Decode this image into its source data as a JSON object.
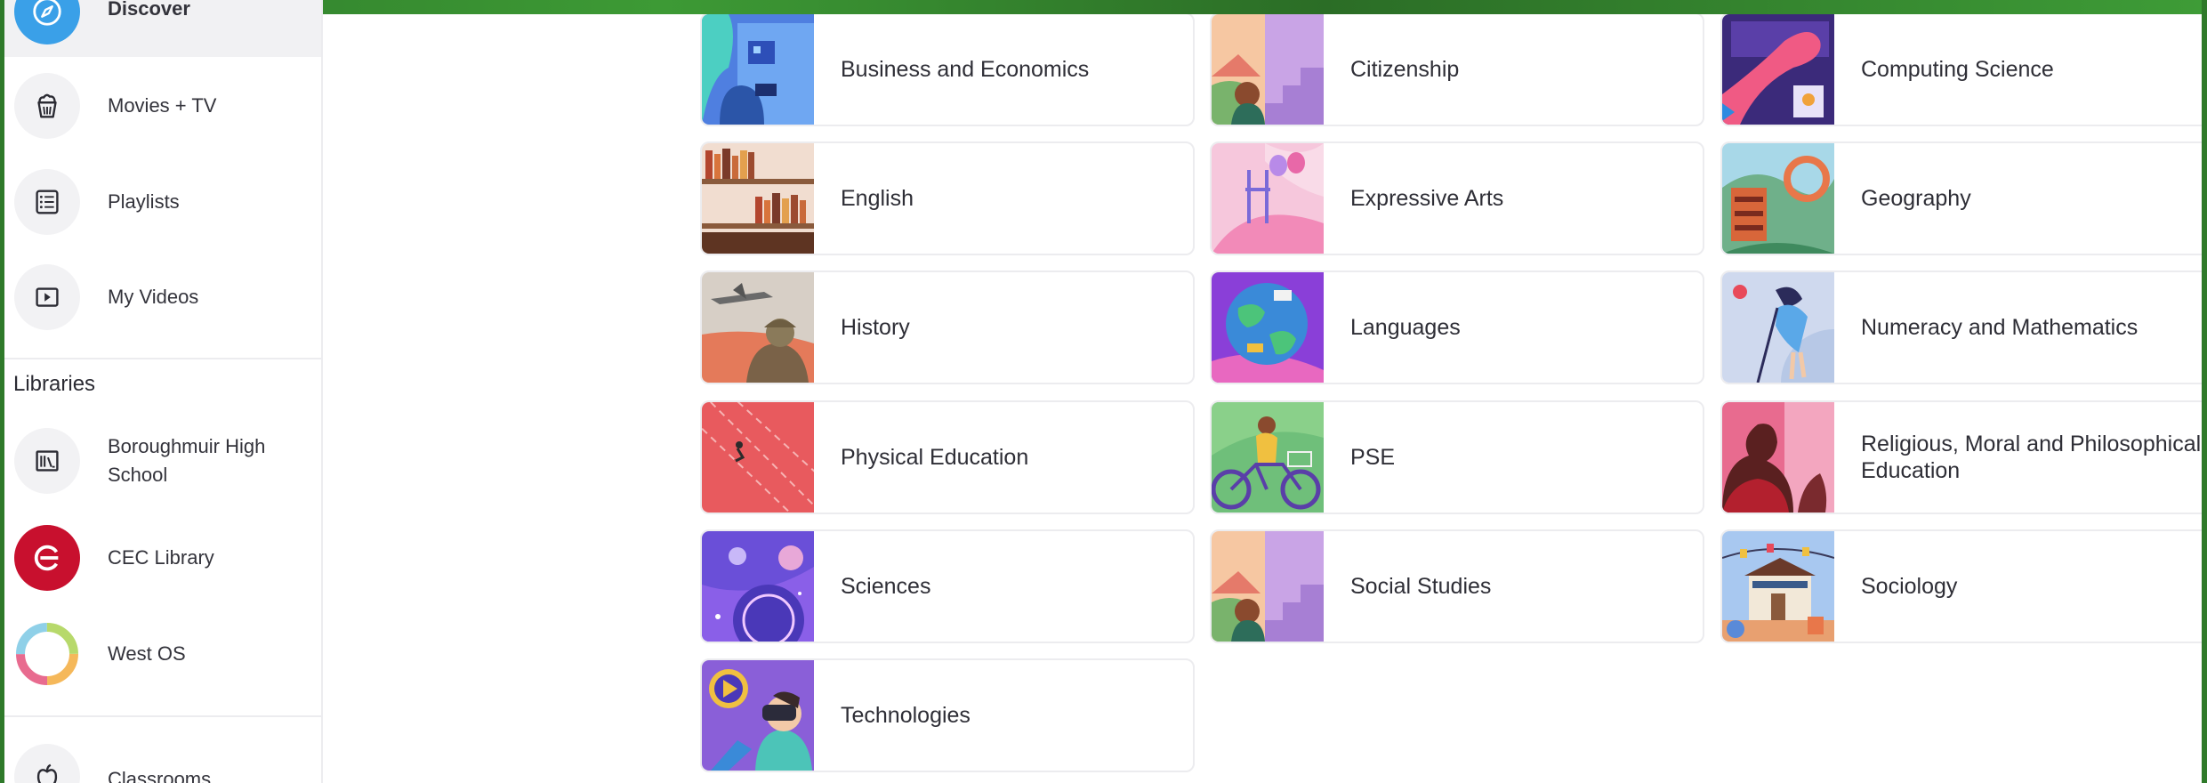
{
  "sidebar": {
    "nav": [
      {
        "label": "Discover",
        "icon": "compass-icon",
        "active": true
      },
      {
        "label": "Movies + TV",
        "icon": "popcorn-icon"
      },
      {
        "label": "Playlists",
        "icon": "list-icon"
      },
      {
        "label": "My Videos",
        "icon": "play-icon"
      }
    ],
    "libraries_heading": "Libraries",
    "libraries": [
      {
        "label": "Boroughmuir High School",
        "icon": "library-icon"
      },
      {
        "label": "CEC Library",
        "icon": "cec-logo-icon",
        "color": "#c8102e"
      },
      {
        "label": "West OS",
        "icon": "ring-logo-icon"
      }
    ],
    "classrooms": {
      "label": "Classrooms",
      "icon": "apple-icon"
    }
  },
  "categories": [
    {
      "label": "Business and Economics",
      "thumb": "business"
    },
    {
      "label": "Citizenship",
      "thumb": "citizenship"
    },
    {
      "label": "Computing Science",
      "thumb": "computing"
    },
    {
      "label": "English",
      "thumb": "english"
    },
    {
      "label": "Expressive Arts",
      "thumb": "arts"
    },
    {
      "label": "Geography",
      "thumb": "geography"
    },
    {
      "label": "History",
      "thumb": "history"
    },
    {
      "label": "Languages",
      "thumb": "languages"
    },
    {
      "label": "Numeracy and Mathematics",
      "thumb": "maths"
    },
    {
      "label": "Physical Education",
      "thumb": "pe"
    },
    {
      "label": "PSE",
      "thumb": "pse"
    },
    {
      "label": "Religious, Moral and Philosophical Education",
      "thumb": "rmps"
    },
    {
      "label": "Sciences",
      "thumb": "sciences"
    },
    {
      "label": "Social Studies",
      "thumb": "social"
    },
    {
      "label": "Sociology",
      "thumb": "sociology"
    },
    {
      "label": "Technologies",
      "thumb": "technologies"
    }
  ],
  "colors": {
    "frame": "#2f7a2a",
    "accent_blue": "#3aa0e8",
    "card_border": "#ececef"
  }
}
